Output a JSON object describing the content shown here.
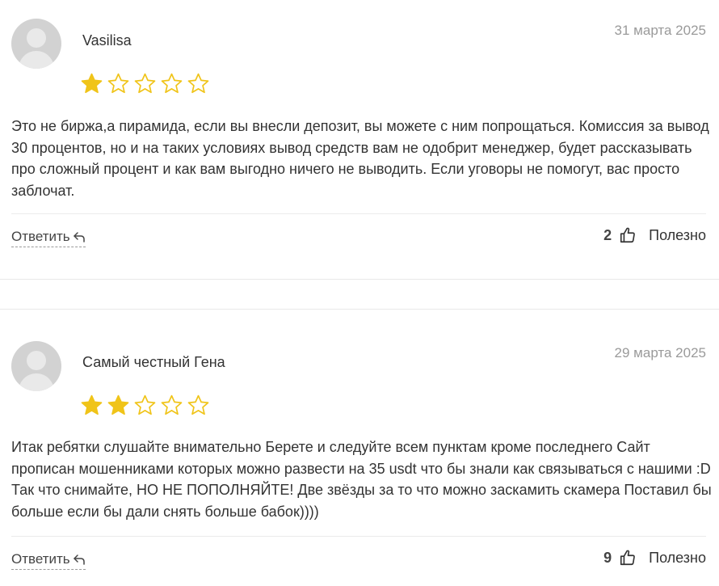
{
  "colors": {
    "star_filled": "#f0c419",
    "star_outline": "#f0c419",
    "date": "#9a9a9a",
    "text": "#333333"
  },
  "reviews": [
    {
      "author": "Vasilisa",
      "date": "31 марта 2025",
      "rating": 1,
      "max_rating": 5,
      "text": "Это не биржа,а пирамида, если вы внесли депозит, вы можете с ним попрощаться. Комиссия за вывод 30 процентов, но и на таких условиях вывод средств вам не одобрит менеджер, будет рассказывать про сложный процент и как вам выгодно ничего не выводить. Если уговоры не помогут, вас просто заблочат.",
      "reply_label": "Ответить",
      "helpful_count": "2",
      "helpful_label": "Полезно",
      "avatar_icon": "user-avatar-placeholder",
      "reply_icon": "reply-arrow-icon",
      "thumb_icon": "thumbs-up-icon"
    },
    {
      "author": "Самый честный Гена",
      "date": "29 марта 2025",
      "rating": 2,
      "max_rating": 5,
      "text": "Итак ребятки слушайте внимательно Берете и следуйте всем пунктам кроме последнего Сайт прописан мошенниками которых можно развести на 35 usdt что бы знали как связываться с нашими :D Так что снимайте, НО НЕ ПОПОЛНЯЙТЕ! Две звёзды за то что можно заскамить скамера Поставил бы больше если бы дали снять больше бабок))))",
      "reply_label": "Ответить",
      "helpful_count": "9",
      "helpful_label": "Полезно",
      "avatar_icon": "user-avatar-placeholder",
      "reply_icon": "reply-arrow-icon",
      "thumb_icon": "thumbs-up-icon"
    }
  ]
}
